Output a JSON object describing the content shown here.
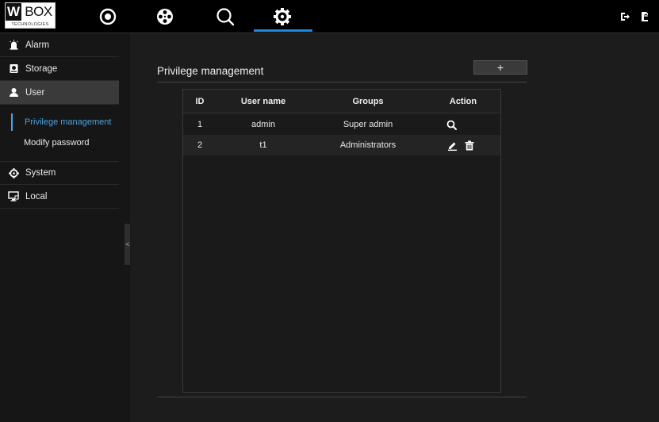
{
  "brand": {
    "logo_w": "W",
    "logo_box": "BOX",
    "logo_sub": "TECHNOLOGIES"
  },
  "topnav": {
    "items": [
      {
        "icon": "live-view-icon"
      },
      {
        "icon": "playback-reel-icon"
      },
      {
        "icon": "search-icon"
      },
      {
        "icon": "settings-gear-icon",
        "active": true
      }
    ],
    "right_icons": [
      "logout-icon",
      "lock-icon"
    ],
    "accent": "#1e88e5"
  },
  "sidebar": {
    "items": [
      {
        "label": "Alarm",
        "icon": "alarm-light-icon"
      },
      {
        "label": "Storage",
        "icon": "storage-disk-icon"
      },
      {
        "label": "User",
        "icon": "user-icon",
        "active": true
      },
      {
        "label": "System",
        "icon": "system-gear-icon"
      },
      {
        "label": "Local",
        "icon": "local-monitor-icon"
      }
    ],
    "user_subitems": [
      {
        "label": "Privilege management",
        "active": true
      },
      {
        "label": "Modify password"
      }
    ],
    "collapse_glyph": "<"
  },
  "main": {
    "title": "Privilege management",
    "add_button": "+",
    "table": {
      "columns": [
        "ID",
        "User name",
        "Groups",
        "Action"
      ],
      "rows": [
        {
          "id": "1",
          "username": "admin",
          "group": "Super admin",
          "actions": [
            "view-icon"
          ]
        },
        {
          "id": "2",
          "username": "t1",
          "group": "Administrators",
          "actions": [
            "edit-icon",
            "delete-icon"
          ]
        }
      ]
    }
  }
}
